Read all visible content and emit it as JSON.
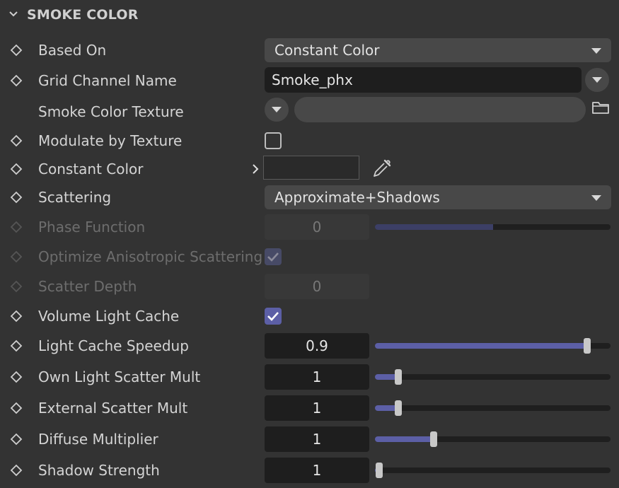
{
  "section": {
    "title": "SMOKE COLOR",
    "icon": "chevron-down-icon"
  },
  "rows": {
    "based_on": {
      "label": "Based On",
      "value": "Constant Color"
    },
    "grid_channel": {
      "label": "Grid Channel Name",
      "value": "Smoke_phx"
    },
    "smoke_texture": {
      "label": "Smoke Color Texture",
      "value": ""
    },
    "modulate": {
      "label": "Modulate by Texture",
      "checked": false
    },
    "constant_color": {
      "label": "Constant Color"
    },
    "scattering": {
      "label": "Scattering",
      "value": "Approximate+Shadows"
    },
    "phase_function": {
      "label": "Phase Function",
      "value": "0",
      "slider_fraction": 0.5
    },
    "optimize_aniso": {
      "label": "Optimize Anisotropic Scattering",
      "checked": true
    },
    "scatter_depth": {
      "label": "Scatter Depth",
      "value": "0"
    },
    "volume_light_cache": {
      "label": "Volume Light Cache",
      "checked": true
    },
    "light_cache_speedup": {
      "label": "Light Cache Speedup",
      "value": "0.9",
      "slider_fraction": 0.9
    },
    "own_light_scatter": {
      "label": "Own Light Scatter Mult",
      "value": "1",
      "slider_fraction": 0.1
    },
    "external_scatter": {
      "label": "External Scatter Mult",
      "value": "1",
      "slider_fraction": 0.1
    },
    "diffuse_multiplier": {
      "label": "Diffuse Multiplier",
      "value": "1",
      "slider_fraction": 0.25
    },
    "shadow_strength": {
      "label": "Shadow Strength",
      "value": "1",
      "slider_fraction": 0.0
    }
  },
  "colors": {
    "accent": "#5c5fa6",
    "background": "#333333",
    "field": "#1e1e1e"
  }
}
